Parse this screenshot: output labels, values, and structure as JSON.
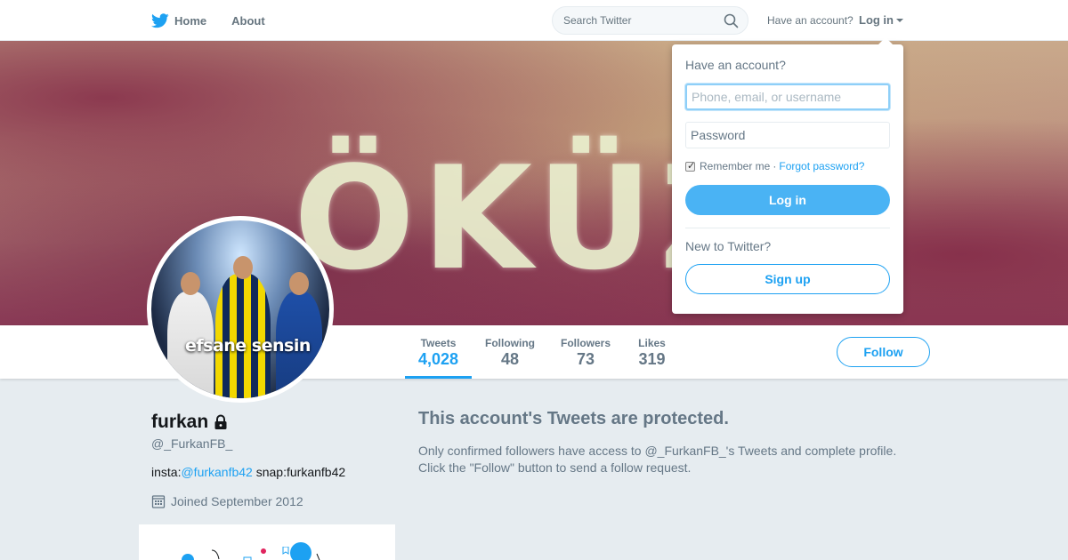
{
  "nav": {
    "home_label": "Home",
    "about_label": "About",
    "search_placeholder": "Search Twitter",
    "have_account": "Have an account?",
    "login_label": "Log in"
  },
  "banner": {
    "text": "ÖKÜZ"
  },
  "avatar": {
    "text": "efsane sensin"
  },
  "stats": [
    {
      "label": "Tweets",
      "value": "4,028"
    },
    {
      "label": "Following",
      "value": "48"
    },
    {
      "label": "Followers",
      "value": "73"
    },
    {
      "label": "Likes",
      "value": "319"
    }
  ],
  "follow_label": "Follow",
  "profile": {
    "name": "furkan",
    "handle": "@_FurkanFB_",
    "bio_prefix": "insta:",
    "bio_link": "@furkanfb42",
    "bio_suffix": " snap:furkanfb42",
    "joined": "Joined September 2012"
  },
  "protected": {
    "title": "This account's Tweets are protected.",
    "body_line1": "Only confirmed followers have access to @_FurkanFB_'s Tweets and complete profile.",
    "body_line2": "Click the \"Follow\" button to send a follow request."
  },
  "login_dropdown": {
    "title": "Have an account?",
    "username_placeholder": "Phone, email, or username",
    "password_placeholder": "Password",
    "remember_label": "Remember me",
    "separator": "·",
    "forgot_label": "Forgot password?",
    "login_button": "Log in",
    "new_to": "New to Twitter?",
    "signup_button": "Sign up"
  },
  "colors": {
    "accent": "#1da1f2",
    "login_button": "#4ab3f4",
    "background": "#e6ecf0",
    "muted_text": "#657786"
  },
  "icons": [
    "twitter-bird-icon",
    "search-icon",
    "chevron-down-icon",
    "lock-icon",
    "calendar-icon"
  ]
}
